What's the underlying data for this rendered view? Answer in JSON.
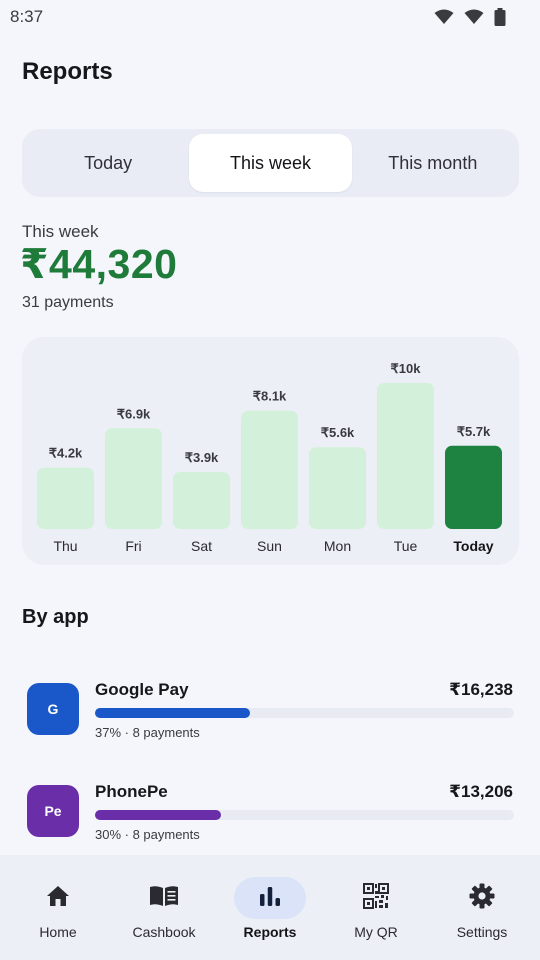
{
  "status_bar": {
    "time": "8:37"
  },
  "header": {
    "title": "Reports"
  },
  "period_tabs": [
    {
      "label": "Today",
      "active": false
    },
    {
      "label": "This week",
      "active": true
    },
    {
      "label": "This month",
      "active": false
    }
  ],
  "summary": {
    "label": "This week",
    "amount": "₹44,320",
    "count": "31 payments"
  },
  "colors": {
    "accent_green": "#1e7b3a",
    "bar_light": "#d3f1da",
    "bar_today": "#1e8240",
    "google_pay": "#1a57c9",
    "phonepe": "#6a2ea8"
  },
  "chart_data": {
    "type": "bar",
    "categories": [
      "Thu",
      "Fri",
      "Sat",
      "Sun",
      "Mon",
      "Tue",
      "Today"
    ],
    "values": [
      4.2,
      6.9,
      3.9,
      8.1,
      5.6,
      10,
      5.7
    ],
    "value_labels": [
      "₹4.2k",
      "₹6.9k",
      "₹3.9k",
      "₹8.1k",
      "₹5.6k",
      "₹10k",
      "₹5.7k"
    ],
    "highlight_index": 6,
    "ylim": [
      0,
      10
    ],
    "unit": "thousand rupees",
    "title": "",
    "xlabel": "",
    "ylabel": "",
    "grid": false
  },
  "by_app": {
    "title": "By app",
    "apps": [
      {
        "icon_text": "G",
        "name": "Google Pay",
        "amount": "₹16,238",
        "share": 0.37,
        "meta": "37% · 8 payments",
        "color": "#1a57c9"
      },
      {
        "icon_text": "Pe",
        "name": "PhonePe",
        "amount": "₹13,206",
        "share": 0.3,
        "meta": "30% · 8 payments",
        "color": "#6a2ea8"
      }
    ]
  },
  "bottom_nav": [
    {
      "label": "Home",
      "icon": "home-icon",
      "active": false
    },
    {
      "label": "Cashbook",
      "icon": "book-icon",
      "active": false
    },
    {
      "label": "Reports",
      "icon": "bar-chart-icon",
      "active": true
    },
    {
      "label": "My QR",
      "icon": "qr-code-icon",
      "active": false
    },
    {
      "label": "Settings",
      "icon": "gear-icon",
      "active": false
    }
  ]
}
